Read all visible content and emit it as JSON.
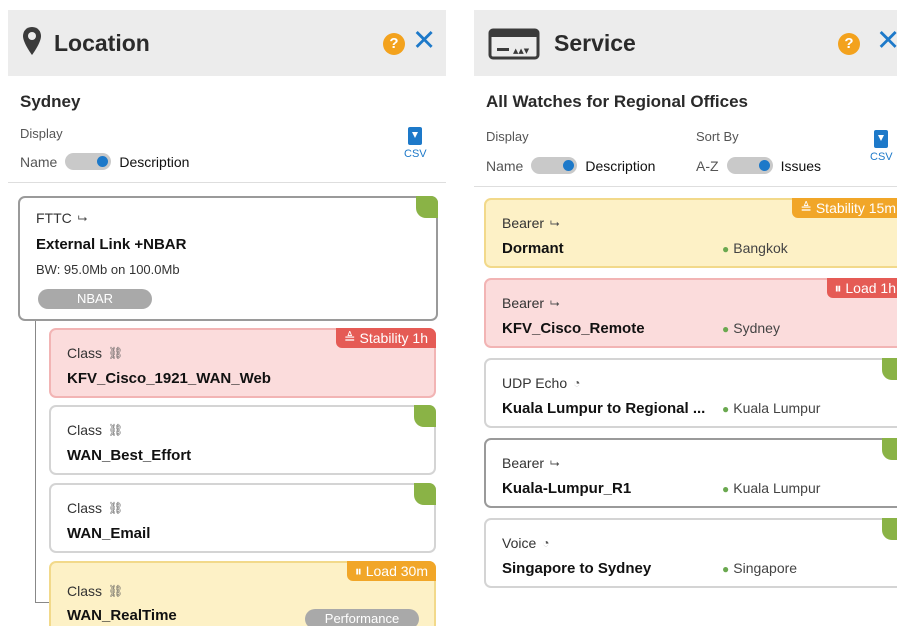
{
  "left_panel": {
    "title": "Location",
    "help": "?",
    "close": "✕",
    "subtitle": "Sydney",
    "display_label": "Display",
    "toggle_left": "Name",
    "toggle_right": "Description",
    "csv_label": "CSV",
    "parent_card": {
      "type": "FTTC",
      "name": "External Link +NBAR",
      "bw": "BW: 95.0Mb on 100.0Mb",
      "pill": "NBAR"
    },
    "children": [
      {
        "type": "Class",
        "name": "KFV_Cisco_1921_WAN_Web",
        "badge": "Stability 1h",
        "status": "red"
      },
      {
        "type": "Class",
        "name": "WAN_Best_Effort",
        "status": "ok"
      },
      {
        "type": "Class",
        "name": "WAN_Email",
        "status": "ok"
      },
      {
        "type": "Class",
        "name": "WAN_RealTime",
        "badge": "Load 30m",
        "status": "orange",
        "pill": "Performance"
      }
    ]
  },
  "right_panel": {
    "title": "Service",
    "help": "?",
    "close": "✕",
    "subtitle": "All Watches for Regional Offices",
    "display_label": "Display",
    "sort_label": "Sort By",
    "toggle1_left": "Name",
    "toggle1_right": "Description",
    "toggle2_left": "A-Z",
    "toggle2_right": "Issues",
    "csv_label": "CSV",
    "cards": [
      {
        "type": "Bearer",
        "name": "Dormant",
        "location": "Bangkok",
        "badge": "Stability 15m",
        "status": "orange"
      },
      {
        "type": "Bearer",
        "name": "KFV_Cisco_Remote",
        "location": "Sydney",
        "badge": "Load 1h",
        "status": "red"
      },
      {
        "type": "UDP Echo",
        "name": "Kuala Lumpur to Regional ...",
        "location": "Kuala Lumpur",
        "status": "ok"
      },
      {
        "type": "Bearer",
        "name": "Kuala-Lumpur_R1",
        "location": "Kuala Lumpur",
        "status": "ok"
      },
      {
        "type": "Voice",
        "name": "Singapore to Sydney",
        "location": "Singapore",
        "status": "ok"
      }
    ]
  },
  "colors": {
    "accent": "#1d79c9",
    "help": "#f3a21d",
    "ok": "#8ab346",
    "red_badge": "#e55b55",
    "orange_badge": "#f1a628",
    "header_bg": "#ececec"
  },
  "icons": {
    "location": "map-pin-icon",
    "service": "monitor-icon",
    "csv": "download-doc-icon",
    "link": "link-icon",
    "class": "class-icon",
    "gauge": "gauge-icon",
    "stability": "stability-icon",
    "load": "load-icon"
  }
}
